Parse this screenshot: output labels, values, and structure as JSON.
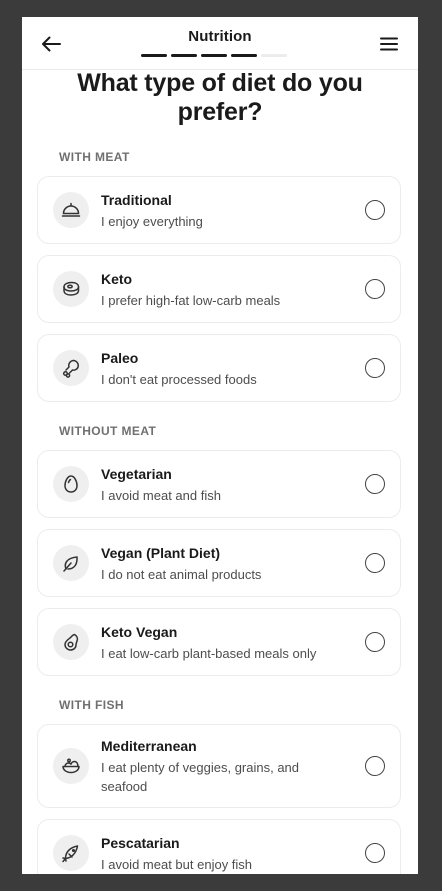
{
  "header": {
    "title": "Nutrition",
    "progress": {
      "completed": 4,
      "total": 5
    }
  },
  "question": "What type of diet do you prefer?",
  "sections": [
    {
      "label": "WITH MEAT",
      "options": [
        {
          "title": "Traditional",
          "desc": "I enjoy everything",
          "icon": "cloche-icon"
        },
        {
          "title": "Keto",
          "desc": "I prefer high-fat low-carb meals",
          "icon": "steak-icon"
        },
        {
          "title": "Paleo",
          "desc": "I don't eat processed foods",
          "icon": "drumstick-icon"
        }
      ]
    },
    {
      "label": "WITHOUT MEAT",
      "options": [
        {
          "title": "Vegetarian",
          "desc": "I avoid meat and fish",
          "icon": "egg-icon"
        },
        {
          "title": "Vegan (Plant Diet)",
          "desc": "I do not eat animal products",
          "icon": "leaf-icon"
        },
        {
          "title": "Keto Vegan",
          "desc": "I eat low-carb plant-based meals only",
          "icon": "avocado-icon"
        }
      ]
    },
    {
      "label": "WITH FISH",
      "options": [
        {
          "title": "Mediterranean",
          "desc": "I eat plenty of veggies, grains, and seafood",
          "icon": "salad-bowl-icon"
        },
        {
          "title": "Pescatarian",
          "desc": "I avoid meat but enjoy fish",
          "icon": "fish-icon"
        }
      ]
    }
  ]
}
